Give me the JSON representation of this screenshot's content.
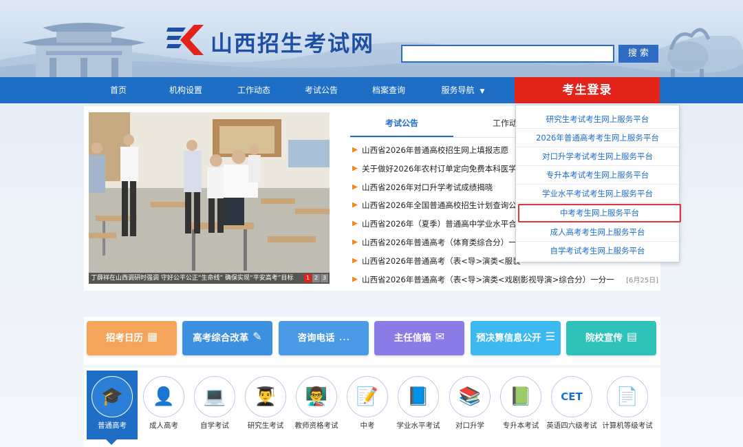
{
  "header": {
    "site_name": "山西招生考试网",
    "search": {
      "placeholder": "",
      "button": "搜 索"
    }
  },
  "nav": {
    "items": [
      "首页",
      "机构设置",
      "工作动态",
      "考试公告",
      "档案查询",
      "服务导航"
    ],
    "login": "考生登录"
  },
  "slideshow": {
    "caption": "丁薛祥在山西调研时强调 守好公平公正“生命线” 确保实现“平安高考”目标",
    "pages": [
      "1",
      "2",
      "3"
    ]
  },
  "tabs": [
    "考试公告",
    "工作动态"
  ],
  "news": [
    {
      "title": "山西省2026年普通高校招生网上填报志愿",
      "date": ""
    },
    {
      "title": "关于做好2026年农村订单定向免费本科医学",
      "date": ""
    },
    {
      "title": "山西省2026年对口升学考试成绩揭晓",
      "date": ""
    },
    {
      "title": "山西省2026年全国普通高校招生计划查询公",
      "date": ""
    },
    {
      "title": "山西省2026年（夏季）普通高中学业水平合",
      "date": ""
    },
    {
      "title": "山西省2026年普通高考（体育类综合分）一",
      "date": ""
    },
    {
      "title": "山西省2026年普通高考（表<导>演类<服装",
      "date": ""
    },
    {
      "title": "山西省2026年普通高考（表<导>演类<戏剧影视导演>综合分）一分一",
      "date": "[6月25日]"
    }
  ],
  "dropdown": {
    "items": [
      "研究生考试考生网上服务平台",
      "2026年普通高考考生网上服务平台",
      "对口升学考试考生网上服务平台",
      "专升本考试考生网上服务平台",
      "学业水平考试考生网上服务平台",
      "中考考生网上服务平台",
      "成人高考考生网上服务平台",
      "自学考试考生网上服务平台"
    ],
    "highlight_index": 5
  },
  "quick_links": [
    {
      "label": "招考日历",
      "icon": "calendar-icon",
      "color": "#f4a55b"
    },
    {
      "label": "高考综合改革",
      "icon": "document-edit-icon",
      "color": "#3d8fe0"
    },
    {
      "label": "咨询电话",
      "icon": "chat-icon",
      "color": "#4b9ae6"
    },
    {
      "label": "主任信箱",
      "icon": "mail-icon",
      "color": "#8b7be6"
    },
    {
      "label": "预决算信息公开",
      "icon": "clipboard-icon",
      "color": "#3cb9ef"
    },
    {
      "label": "院校宣传",
      "icon": "briefcase-icon",
      "color": "#2fc2b9"
    }
  ],
  "categories": [
    {
      "label": "普通高考",
      "icon": "graduation-cap-icon"
    },
    {
      "label": "成人高考",
      "icon": "adult-student-icon"
    },
    {
      "label": "自学考试",
      "icon": "laptop-study-icon"
    },
    {
      "label": "研究生考试",
      "icon": "graduate-icon"
    },
    {
      "label": "教师资格考试",
      "icon": "teacher-podium-icon"
    },
    {
      "label": "中考",
      "icon": "exam-paper-icon"
    },
    {
      "label": "学业水平考试",
      "icon": "book-icon"
    },
    {
      "label": "对口升学",
      "icon": "cap-books-icon"
    },
    {
      "label": "专升本考试",
      "icon": "books-stack-icon"
    },
    {
      "label": "英语四六级考试",
      "icon": "cet-icon",
      "text": "CET"
    },
    {
      "label": "计算机等级考试",
      "icon": "certificate-icon"
    }
  ],
  "colors": {
    "nav": "#1f6ec6",
    "login": "#e2231a",
    "highlight_border": "#e2323a"
  }
}
